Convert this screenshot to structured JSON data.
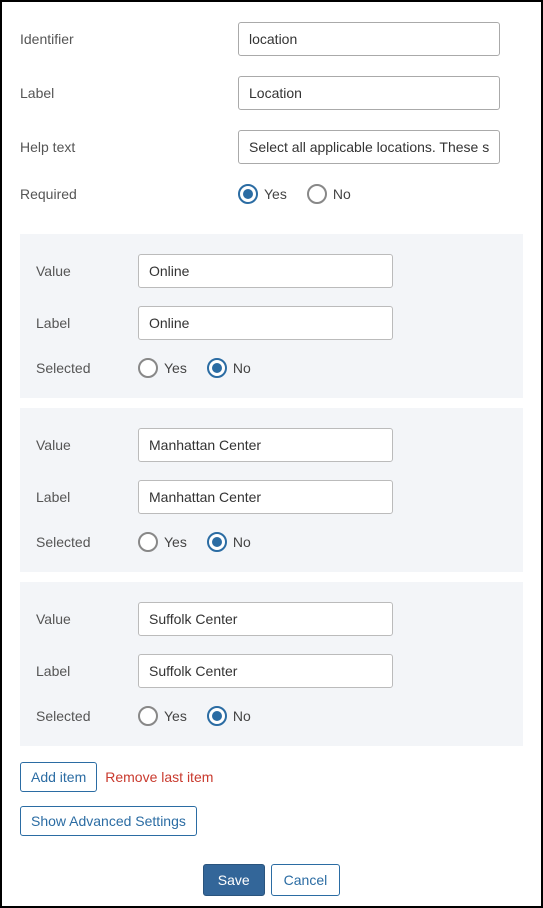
{
  "form": {
    "identifier_label": "Identifier",
    "identifier_value": "location",
    "label_label": "Label",
    "label_value": "Location",
    "help_label": "Help text",
    "help_value": "Select all applicable locations. These s",
    "required_label": "Required",
    "yes": "Yes",
    "no": "No",
    "required_selected": "yes"
  },
  "item_labels": {
    "value": "Value",
    "label": "Label",
    "selected": "Selected"
  },
  "items": [
    {
      "value": "Online",
      "label": "Online",
      "selected": "no"
    },
    {
      "value": "Manhattan Center",
      "label": "Manhattan Center",
      "selected": "no"
    },
    {
      "value": "Suffolk Center",
      "label": "Suffolk Center",
      "selected": "no"
    }
  ],
  "buttons": {
    "add_item": "Add item",
    "remove_last": "Remove last item",
    "advanced": "Show Advanced Settings",
    "save": "Save",
    "cancel": "Cancel"
  }
}
